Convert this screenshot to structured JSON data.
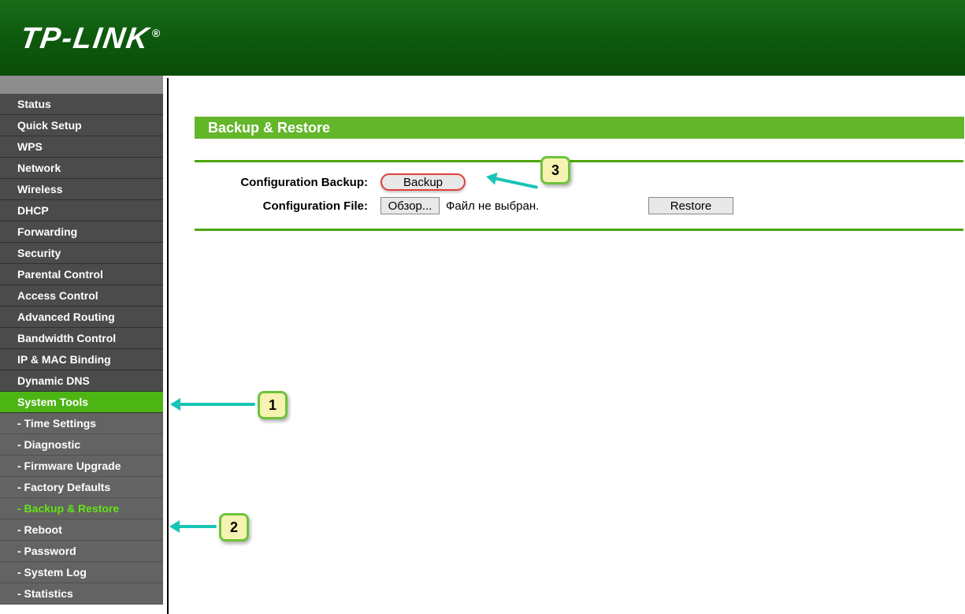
{
  "brand": "TP-LINK",
  "sidebar": {
    "items": [
      {
        "label": "Status"
      },
      {
        "label": "Quick Setup"
      },
      {
        "label": "WPS"
      },
      {
        "label": "Network"
      },
      {
        "label": "Wireless"
      },
      {
        "label": "DHCP"
      },
      {
        "label": "Forwarding"
      },
      {
        "label": "Security"
      },
      {
        "label": "Parental Control"
      },
      {
        "label": "Access Control"
      },
      {
        "label": "Advanced Routing"
      },
      {
        "label": "Bandwidth Control"
      },
      {
        "label": "IP & MAC Binding"
      },
      {
        "label": "Dynamic DNS"
      },
      {
        "label": "System Tools",
        "selected": true
      }
    ],
    "subitems": [
      {
        "label": "- Time Settings"
      },
      {
        "label": "- Diagnostic"
      },
      {
        "label": "- Firmware Upgrade"
      },
      {
        "label": "- Factory Defaults"
      },
      {
        "label": "- Backup & Restore",
        "active": true
      },
      {
        "label": "- Reboot"
      },
      {
        "label": "- Password"
      },
      {
        "label": "- System Log"
      },
      {
        "label": "- Statistics"
      }
    ]
  },
  "page": {
    "title": "Backup & Restore",
    "config_backup_label": "Configuration Backup:",
    "config_file_label": "Configuration File:",
    "backup_btn": "Backup",
    "browse_btn": "Обзор...",
    "file_status": "Файл не выбран.",
    "restore_btn": "Restore"
  },
  "callouts": {
    "c1": "1",
    "c2": "2",
    "c3": "3"
  }
}
